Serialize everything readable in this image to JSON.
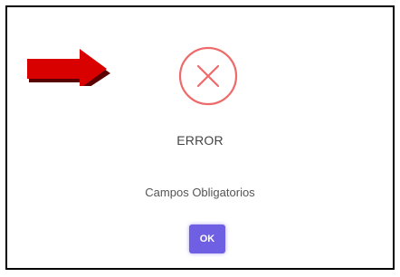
{
  "dialog": {
    "title": "ERROR",
    "message": "Campos Obligatorios",
    "ok_label": "OK",
    "icon": "error-x-circle-icon"
  },
  "annotation": {
    "icon": "red-arrow-right-icon"
  },
  "colors": {
    "error_icon": "#ef6b6b",
    "ok_button": "#6e5fe3",
    "arrow": "#d90000",
    "frame_border": "#000000"
  }
}
